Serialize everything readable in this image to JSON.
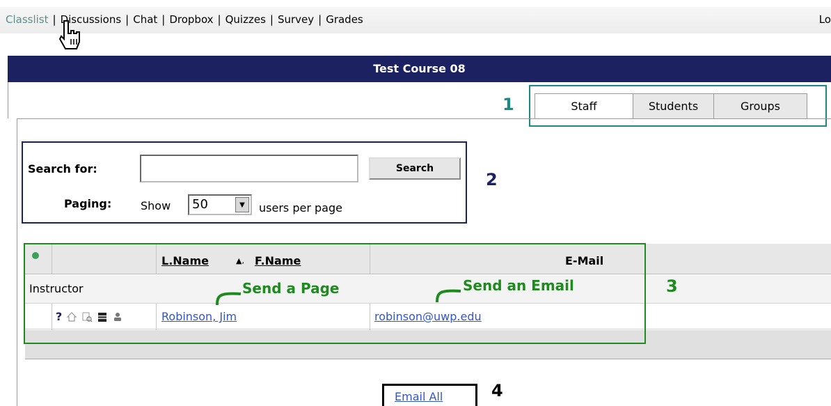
{
  "nav": {
    "items": [
      "Classlist",
      "Discussions",
      "Chat",
      "Dropbox",
      "Quizzes",
      "Survey",
      "Grades"
    ],
    "active": "Classlist",
    "right_label": "Lo"
  },
  "course": {
    "title": "Test Course 08"
  },
  "tabs": [
    "Staff",
    "Students",
    "Groups"
  ],
  "active_tab": "Staff",
  "annotations": {
    "one": "1",
    "two": "2",
    "three": "3",
    "four": "4",
    "send_page": "Send a Page",
    "send_email": "Send an Email"
  },
  "search": {
    "label": "Search for:",
    "value": "",
    "button": "Search"
  },
  "paging": {
    "label": "Paging:",
    "show": "Show",
    "per_page": "50",
    "suffix": "users per page"
  },
  "table": {
    "col_lname": "L.Name",
    "sort_indicator": "▲",
    "col_sep": ",",
    "col_fname": "F.Name",
    "col_email": "E-Mail",
    "group": "Instructor",
    "rows": [
      {
        "name": "Robinson, Jim",
        "email": "robinson@uwp.edu",
        "help_icon": "?"
      }
    ]
  },
  "actions": {
    "email_all": "Email All"
  }
}
